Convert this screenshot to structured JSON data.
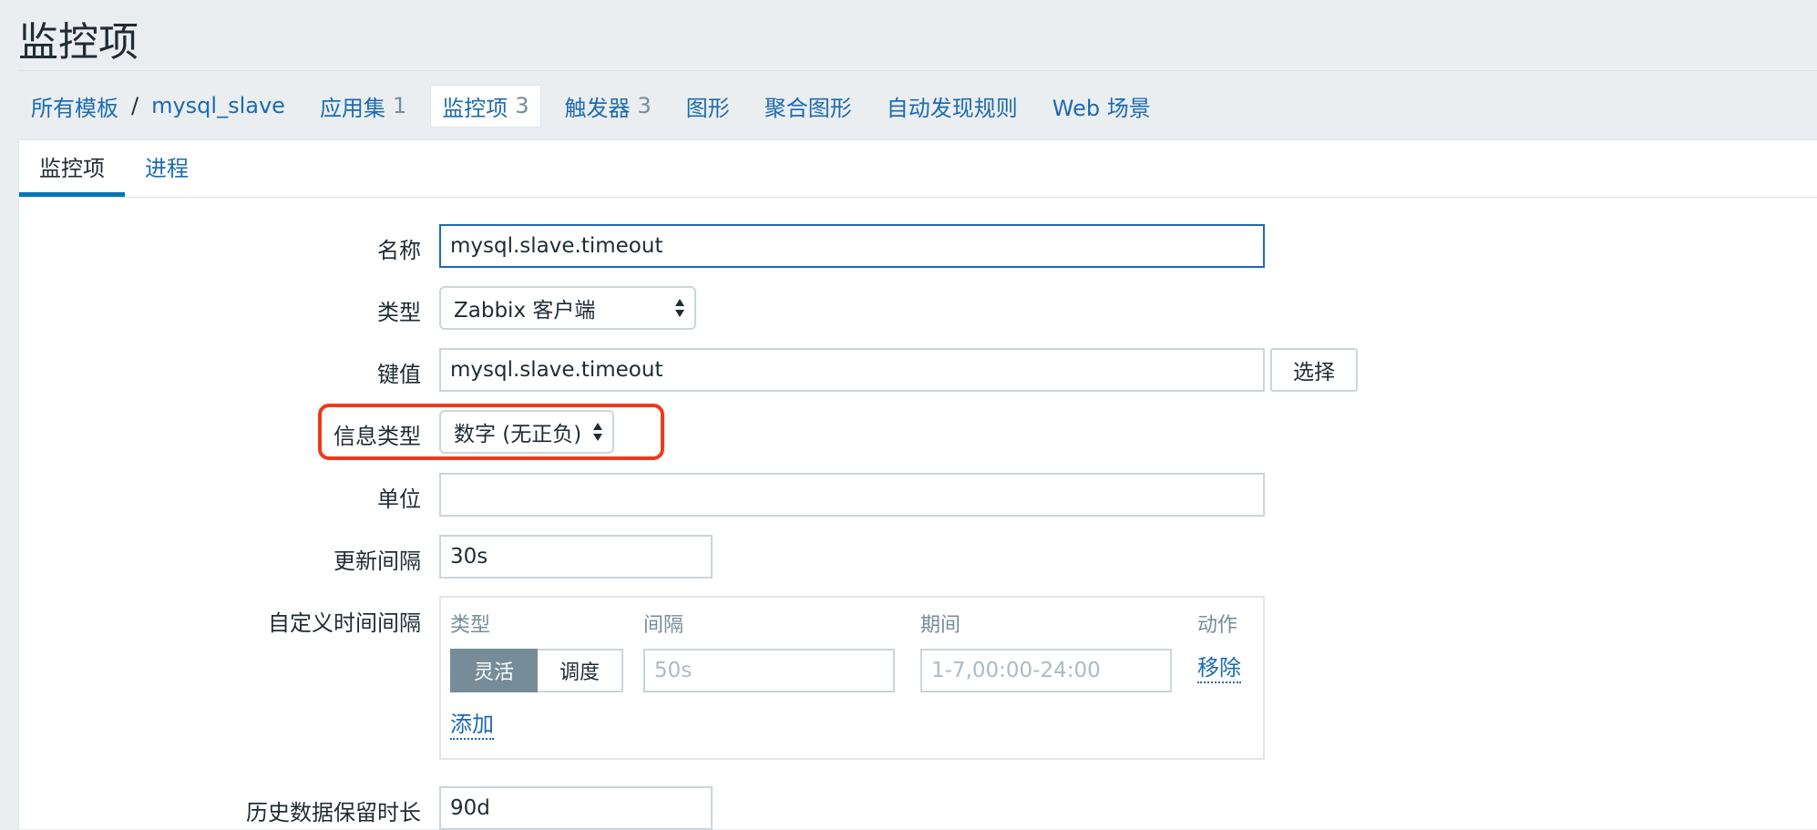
{
  "page_title": "监控项",
  "breadcrumb": {
    "root": "所有模板",
    "separator": "/",
    "template": "mysql_slave",
    "items": [
      {
        "label": "应用集",
        "count": "1"
      },
      {
        "label": "监控项",
        "count": "3"
      },
      {
        "label": "触发器",
        "count": "3"
      },
      {
        "label": "图形",
        "count": ""
      },
      {
        "label": "聚合图形",
        "count": ""
      },
      {
        "label": "自动发现规则",
        "count": ""
      },
      {
        "label": "Web 场景",
        "count": ""
      }
    ]
  },
  "tabs": [
    {
      "label": "监控项"
    },
    {
      "label": "进程"
    }
  ],
  "form": {
    "name": {
      "label": "名称",
      "value": "mysql.slave.timeout"
    },
    "type": {
      "label": "类型",
      "value": "Zabbix 客户端"
    },
    "key": {
      "label": "键值",
      "value": "mysql.slave.timeout",
      "select_button": "选择"
    },
    "info_type": {
      "label": "信息类型",
      "value": "数字 (无正负)"
    },
    "units": {
      "label": "单位",
      "value": ""
    },
    "update_interval": {
      "label": "更新间隔",
      "value": "30s"
    },
    "custom_intervals": {
      "label": "自定义时间间隔",
      "headers": {
        "type": "类型",
        "interval": "间隔",
        "period": "期间",
        "action": "动作"
      },
      "type_flexible": "灵活",
      "type_scheduling": "调度",
      "interval_placeholder": "50s",
      "period_placeholder": "1-7,00:00-24:00",
      "remove": "移除",
      "add": "添加"
    },
    "history": {
      "label": "历史数据保留时长",
      "value": "90d"
    }
  },
  "colors": {
    "accent": "#1c6bb0",
    "highlight": "#ee3a1a",
    "tab_indicator": "#0275b8"
  }
}
